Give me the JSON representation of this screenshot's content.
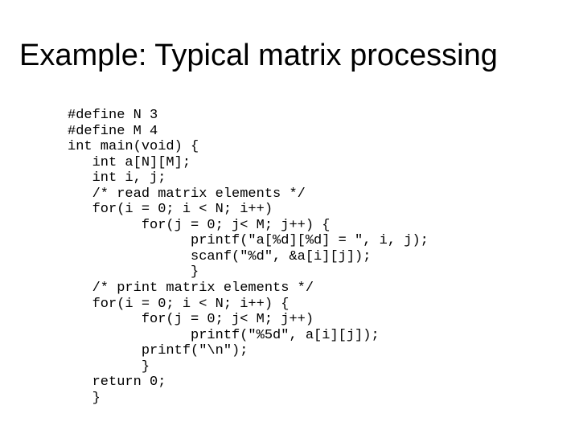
{
  "title": "Example: Typical matrix processing",
  "code": "#define N 3\n#define M 4\nint main(void) {\n   int a[N][M];\n   int i, j;\n   /* read matrix elements */\n   for(i = 0; i < N; i++)\n         for(j = 0; j< M; j++) {\n               printf(\"a[%d][%d] = \", i, j);\n               scanf(\"%d\", &a[i][j]);\n               }\n   /* print matrix elements */\n   for(i = 0; i < N; i++) {\n         for(j = 0; j< M; j++)\n               printf(\"%5d\", a[i][j]);\n         printf(\"\\n\");\n         }\n   return 0;\n   }"
}
